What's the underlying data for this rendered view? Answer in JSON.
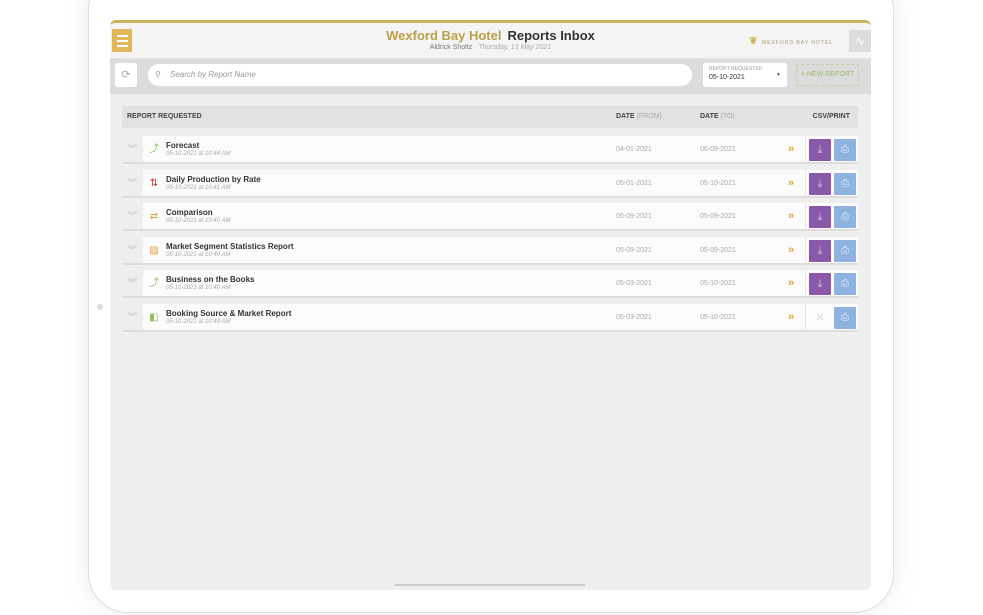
{
  "header": {
    "hotel": "Wexford Bay Hotel",
    "title": "Reports Inbox",
    "user": "Aldrick Sholtz",
    "date": "Thursday, 13 May 2021",
    "logo": "WEXFORD BAY HOTEL"
  },
  "toolbar": {
    "search_placeholder": "Search by Report Name",
    "filter_label": "REPORT REQUESTED",
    "filter_value": "05-10-2021",
    "new_report": "+ NEW REPORT"
  },
  "table": {
    "col_report": "REPORT REQUESTED",
    "col_from": "DATE",
    "col_from_sub": "(FROM)",
    "col_to": "DATE",
    "col_to_sub": "(TO)",
    "col_csv": "CSV/PRINT"
  },
  "rows": [
    {
      "name": "Forecast",
      "ts": "05-10-2021 at 10:44 AM",
      "from": "04-01-2021",
      "to": "06-09-2021",
      "icon": "trend-up-icon",
      "csv": true
    },
    {
      "name": "Daily Production by Rate",
      "ts": "05-10-2021 at 10:41 AM",
      "from": "05-01-2021",
      "to": "05-10-2021",
      "icon": "up-down-arrows-icon",
      "csv": true
    },
    {
      "name": "Comparison",
      "ts": "05-10-2021 at 10:40 AM",
      "from": "05-09-2021",
      "to": "05-09-2021",
      "icon": "swap-icon",
      "csv": true
    },
    {
      "name": "Market Segment Statistics Report",
      "ts": "05-10-2021 at 10:40 AM",
      "from": "05-09-2021",
      "to": "05-09-2021",
      "icon": "chart-icon",
      "csv": true
    },
    {
      "name": "Business on the Books",
      "ts": "05-10-2021 at 10:40 AM",
      "from": "05-03-2021",
      "to": "05-10-2021",
      "icon": "trend-up-icon",
      "csv": true
    },
    {
      "name": "Booking Source & Market Report",
      "ts": "05-10-2021 at 10:40 AM",
      "from": "05-03-2021",
      "to": "05-10-2021",
      "icon": "source-icon",
      "csv": false
    }
  ]
}
